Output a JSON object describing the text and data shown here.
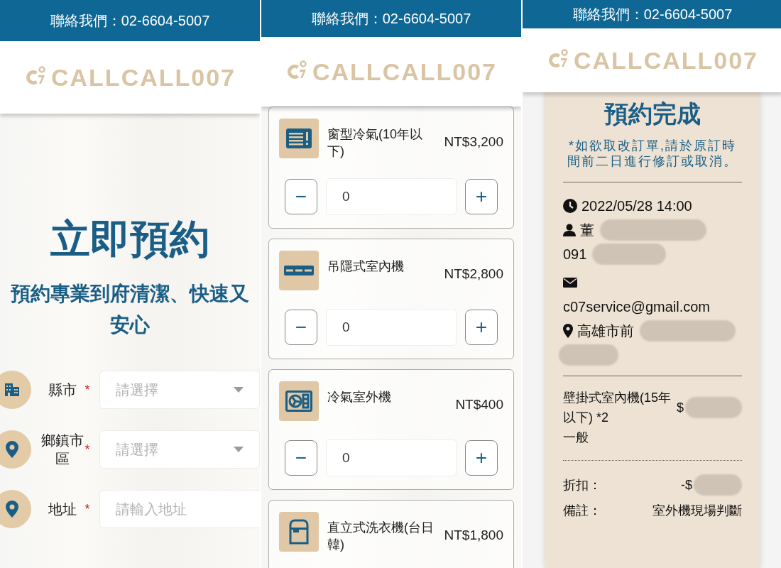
{
  "panels": [
    {
      "kind": "booking_form",
      "contact": "聯絡我們：02-6604-5007",
      "logo": "CALLCALL007",
      "title": "立即預約",
      "subtitle": "預約專業到府清潔、快速又安心",
      "fields": [
        {
          "kind": "select",
          "label": "縣市",
          "required_mark": "*",
          "placeholder": "請選擇"
        },
        {
          "kind": "select",
          "label": "鄉鎮市區",
          "required_mark": "*",
          "placeholder": "請選擇"
        },
        {
          "kind": "text",
          "label": "地址",
          "required_mark": "*",
          "placeholder": "請輸入地址"
        }
      ]
    },
    {
      "kind": "service_list",
      "contact": "聯絡我們：02-6604-5007",
      "logo": "CALLCALL007",
      "services": [
        {
          "name": "窗型冷氣(10年以下)",
          "price": "NT$3,200",
          "stepper": {
            "minus": "−",
            "value": "0",
            "plus": "+"
          }
        },
        {
          "name": "吊隱式室內機",
          "price": "NT$2,800",
          "stepper": {
            "minus": "−",
            "value": "0",
            "plus": "+"
          }
        },
        {
          "name": "冷氣室外機",
          "price": "NT$400",
          "stepper": {
            "minus": "−",
            "value": "0",
            "plus": "+"
          }
        },
        {
          "name": "直立式洗衣機(台日韓)",
          "price": "NT$1,800"
        }
      ]
    },
    {
      "kind": "confirmation",
      "contact": "聯絡我們：02-6604-5007",
      "logo": "CALLCALL007",
      "title": "預約完成",
      "note": "*如欲取改訂單,請於原訂時間前二日進行修訂或取消。",
      "datetime": "2022/05/28 14:00",
      "name": {
        "text": "董",
        "redacted": true
      },
      "phone": {
        "text": "091",
        "redacted": true
      },
      "email": "c07service@gmail.com",
      "address": {
        "text": "高雄市前",
        "redacted": true
      },
      "items": [
        {
          "name": "壁掛式室內機(15年以下) *2",
          "price": {
            "text": "$",
            "redacted": true
          },
          "type": "一般"
        }
      ],
      "discount": {
        "label": "折扣：",
        "value": {
          "text": "-$",
          "redacted": true
        }
      },
      "remark": {
        "label": "備註：",
        "value": "室外機現場判斷"
      }
    }
  ]
}
